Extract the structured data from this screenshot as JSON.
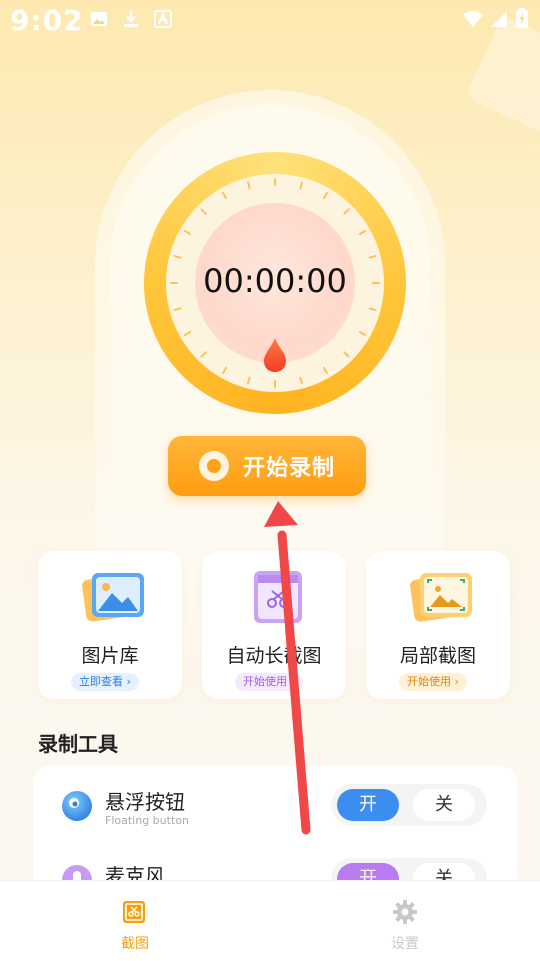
{
  "status_bar": {
    "time": "9:02"
  },
  "timer": {
    "value": "00:00:00"
  },
  "start_button": {
    "label": "开始录制"
  },
  "quick_actions": [
    {
      "title": "图片库",
      "badge": "立即查看 ›"
    },
    {
      "title": "自动长截图",
      "badge": "开始使用 ›"
    },
    {
      "title": "局部截图",
      "badge": "开始使用 ›"
    }
  ],
  "tools_section": {
    "title": "录制工具",
    "items": [
      {
        "name": "悬浮按钮",
        "subtitle": "Floating button",
        "on_label": "开",
        "off_label": "关",
        "state": "on"
      },
      {
        "name": "麦克风",
        "subtitle": "",
        "on_label": "开",
        "off_label": "关",
        "state": "on"
      }
    ]
  },
  "bottom_nav": {
    "items": [
      {
        "label": "截图",
        "active": true
      },
      {
        "label": "设置",
        "active": false
      }
    ]
  },
  "colors": {
    "accent_orange": "#ff9d10",
    "active_blue": "#3b8ef0",
    "active_purple": "#b97cf0",
    "nav_active": "#f5a10e",
    "nav_inactive": "#c8c8c8",
    "arrow_red": "#f04848"
  }
}
